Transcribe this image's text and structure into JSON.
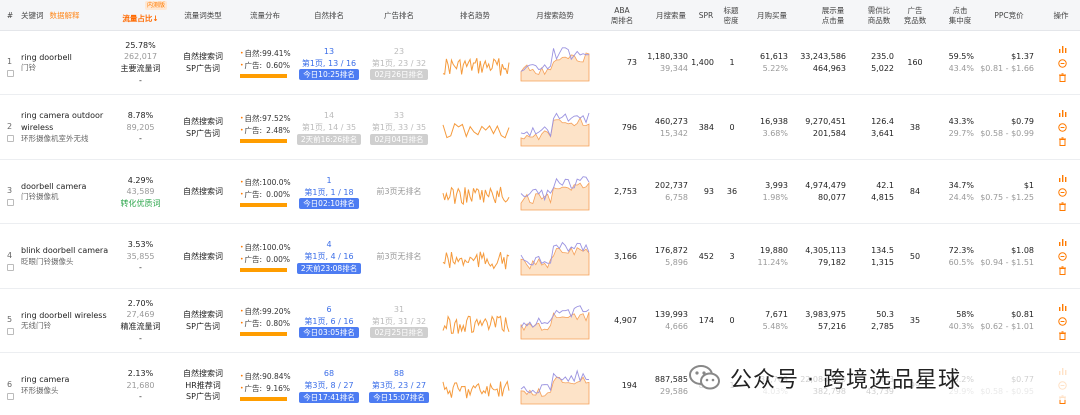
{
  "headers": {
    "idx": "#",
    "keyword": "关键词",
    "data_explain": "数据解释",
    "new_badge": "内测版",
    "traffic_share": "流量占比",
    "sort_arrow": "↓",
    "traffic_type": "流量词类型",
    "traffic_dist": "流量分布",
    "natural_rank": "自然排名",
    "ad_rank": "广告排名",
    "rank_trend": "排名趋势",
    "search_trend": "月搜索趋势",
    "aba_l1": "ABA",
    "aba_l2": "周排名",
    "monthly_search": "月搜索量",
    "spr": "SPR",
    "title_density_l1": "标题",
    "title_density_l2": "密度",
    "monthly_purchase": "月购买量",
    "impr_clicks_l1": "展示量",
    "impr_clicks_l2": "点击量",
    "supply_ratio_l1": "需供比",
    "supply_ratio_l2": "商品数",
    "ad_products_l1": "广告",
    "ad_products_l2": "竞品数",
    "click_conc_l1": "点击",
    "click_conc_l2": "集中度",
    "ppc": "PPC竞价",
    "ops": "操作"
  },
  "labels": {
    "natural": "自然:",
    "ad": "广告:"
  },
  "rows": [
    {
      "idx": "1",
      "keyword": "ring doorbell",
      "keyword_cn": "门铃",
      "share": "25.78%",
      "share_count": "262,017",
      "share_tag": "主要流量词",
      "share_tag_color": "dark",
      "share_extra": "-",
      "types": [
        "自然搜索词",
        "SP广告词"
      ],
      "nat_pct": "99.41%",
      "ad_pct": "0.60%",
      "nat_rank": "13",
      "nat_page": "第1页, 13 / 16",
      "nat_time": "今日10:25排名",
      "nat_style": "blue",
      "ad_rank": "23",
      "ad_page": "第1页, 23 / 32",
      "ad_time": "02月26日排名",
      "ad_style": "gray",
      "ad_none": "",
      "aba": "73",
      "search": "1,180,330",
      "search_sub": "39,344",
      "spr": "1,400",
      "density": "1",
      "purchase": "61,613",
      "purchase_pct": "5.22%",
      "impr": "33,243,586",
      "clicks": "464,963",
      "ratio": "235.0",
      "products": "5,022",
      "ad_comp": "160",
      "conc": "59.5%",
      "conc_sub": "43.4%",
      "ppc": "$1.37",
      "ppc_range": "$0.81 - $1.66"
    },
    {
      "idx": "2",
      "keyword": "ring camera outdoor wireless",
      "keyword_cn": "环形摄像机室外无线",
      "share": "8.78%",
      "share_count": "89,205",
      "share_tag": "",
      "share_tag_color": "dark",
      "share_extra": "-",
      "types": [
        "自然搜索词",
        "SP广告词"
      ],
      "nat_pct": "97.52%",
      "ad_pct": "2.48%",
      "nat_rank": "14",
      "nat_page": "第1页, 14 / 35",
      "nat_time": "2天前16:26排名",
      "nat_style": "gray",
      "ad_rank": "33",
      "ad_page": "第1页, 33 / 35",
      "ad_time": "02月04日排名",
      "ad_style": "gray",
      "ad_none": "",
      "aba": "796",
      "search": "460,273",
      "search_sub": "15,342",
      "spr": "384",
      "density": "0",
      "purchase": "16,938",
      "purchase_pct": "3.68%",
      "impr": "9,270,451",
      "clicks": "201,584",
      "ratio": "126.4",
      "products": "3,641",
      "ad_comp": "38",
      "conc": "43.3%",
      "conc_sub": "29.7%",
      "ppc": "$0.79",
      "ppc_range": "$0.58 - $0.99"
    },
    {
      "idx": "3",
      "keyword": "doorbell camera",
      "keyword_cn": "门铃摄像机",
      "share": "4.29%",
      "share_count": "43,589",
      "share_tag": "转化优质词",
      "share_tag_color": "green",
      "share_extra": "",
      "types": [
        "自然搜索词"
      ],
      "nat_pct": "100.0%",
      "ad_pct": "0.00%",
      "nat_rank": "1",
      "nat_page": "第1页, 1 / 18",
      "nat_time": "今日02:10排名",
      "nat_style": "blue",
      "ad_rank": "",
      "ad_page": "",
      "ad_time": "",
      "ad_style": "none",
      "ad_none": "前3页无排名",
      "aba": "2,753",
      "search": "202,737",
      "search_sub": "6,758",
      "spr": "93",
      "density": "36",
      "purchase": "3,993",
      "purchase_pct": "1.98%",
      "impr": "4,974,479",
      "clicks": "80,077",
      "ratio": "42.1",
      "products": "4,815",
      "ad_comp": "84",
      "conc": "34.7%",
      "conc_sub": "24.4%",
      "ppc": "$1",
      "ppc_range": "$0.75 - $1.25"
    },
    {
      "idx": "4",
      "keyword": "blink doorbell camera",
      "keyword_cn": "眨眼门铃摄像头",
      "share": "3.53%",
      "share_count": "35,855",
      "share_tag": "",
      "share_tag_color": "dark",
      "share_extra": "-",
      "types": [
        "自然搜索词"
      ],
      "nat_pct": "100.0%",
      "ad_pct": "0.00%",
      "nat_rank": "4",
      "nat_page": "第1页, 4 / 16",
      "nat_time": "2天前23:08排名",
      "nat_style": "blue",
      "ad_rank": "",
      "ad_page": "",
      "ad_time": "",
      "ad_style": "none",
      "ad_none": "前3页无排名",
      "aba": "3,166",
      "search": "176,872",
      "search_sub": "5,896",
      "spr": "452",
      "density": "3",
      "purchase": "19,880",
      "purchase_pct": "11.24%",
      "impr": "4,305,113",
      "clicks": "79,182",
      "ratio": "134.5",
      "products": "1,315",
      "ad_comp": "50",
      "conc": "72.3%",
      "conc_sub": "60.5%",
      "ppc": "$1.08",
      "ppc_range": "$0.94 - $1.51"
    },
    {
      "idx": "5",
      "keyword": "ring doorbell wireless",
      "keyword_cn": "无线门铃",
      "share": "2.70%",
      "share_count": "27,469",
      "share_tag": "精准流量词",
      "share_tag_color": "dark",
      "share_extra": "-",
      "types": [
        "自然搜索词",
        "SP广告词"
      ],
      "nat_pct": "99.20%",
      "ad_pct": "0.80%",
      "nat_rank": "6",
      "nat_page": "第1页, 6 / 16",
      "nat_time": "今日03:05排名",
      "nat_style": "blue",
      "ad_rank": "31",
      "ad_page": "第1页, 31 / 32",
      "ad_time": "02月25日排名",
      "ad_style": "gray",
      "ad_none": "",
      "aba": "4,907",
      "search": "139,993",
      "search_sub": "4,666",
      "spr": "174",
      "density": "0",
      "purchase": "7,671",
      "purchase_pct": "5.48%",
      "impr": "3,983,975",
      "clicks": "57,216",
      "ratio": "50.3",
      "products": "2,785",
      "ad_comp": "35",
      "conc": "58%",
      "conc_sub": "40.3%",
      "ppc": "$0.81",
      "ppc_range": "$0.62 - $1.01"
    },
    {
      "idx": "6",
      "keyword": "ring camera",
      "keyword_cn": "环形摄像头",
      "share": "2.13%",
      "share_count": "21,680",
      "share_tag": "",
      "share_tag_color": "dark",
      "share_extra": "-",
      "types": [
        "自然搜索词",
        "HR推荐词",
        "SP广告词"
      ],
      "nat_pct": "90.84%",
      "ad_pct": "9.16%",
      "nat_rank": "68",
      "nat_page": "第3页, 8 / 27",
      "nat_time": "今日17:41排名",
      "nat_style": "blue",
      "ad_rank": "88",
      "ad_page": "第3页, 23 / 27",
      "ad_time": "今日15:07排名",
      "ad_style": "blue",
      "ad_none": "",
      "aba": "194",
      "search": "887,585",
      "search_sub": "29,586",
      "spr": "813",
      "density": "1",
      "purchase": "35,769",
      "purchase_pct": "4.03%",
      "impr": "22,084,160",
      "clicks": "382,798",
      "ratio": "20.3",
      "products": "43,739",
      "ad_comp": "99",
      "conc": "43.2%",
      "conc_sub": "29.9%",
      "ppc": "$0.77",
      "ppc_range": "$0.58 - $0.95"
    }
  ],
  "watermark": {
    "text": "公众号 · 跨境选品星球",
    "logo": "wechat-logo"
  },
  "colors": {
    "accent": "#ff7a00",
    "blue": "#4d7cf2",
    "bar": "#ff9d00"
  },
  "icons": [
    "bar-chart-icon",
    "minus-circle-icon",
    "trash-icon"
  ]
}
